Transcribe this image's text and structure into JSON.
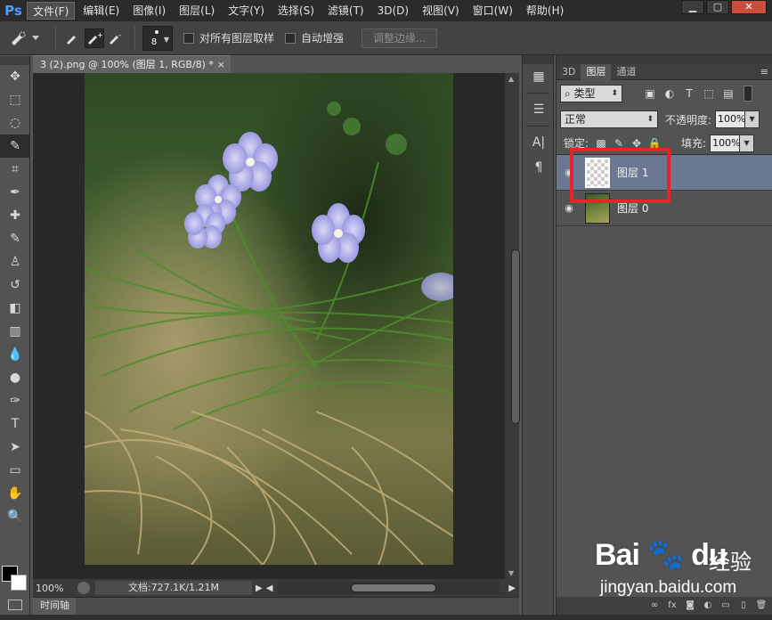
{
  "app": {
    "logo": "Ps",
    "window_buttons": {
      "minimize": "▁",
      "maximize": "▢",
      "close": "✕"
    }
  },
  "menu": {
    "items": [
      {
        "label": "文件(F)",
        "active": true
      },
      {
        "label": "编辑(E)"
      },
      {
        "label": "图像(I)"
      },
      {
        "label": "图层(L)"
      },
      {
        "label": "文字(Y)"
      },
      {
        "label": "选择(S)"
      },
      {
        "label": "滤镜(T)"
      },
      {
        "label": "3D(D)"
      },
      {
        "label": "视图(V)"
      },
      {
        "label": "窗口(W)"
      },
      {
        "label": "帮助(H)"
      }
    ]
  },
  "options": {
    "brush_size": "8",
    "sample_all_layers": "对所有图层取样",
    "auto_enhance": "自动增强",
    "refine_edge": "调整边缘..."
  },
  "tools": [
    {
      "name": "move-tool",
      "icon": "✥"
    },
    {
      "name": "marquee-tool",
      "icon": "⬚"
    },
    {
      "name": "lasso-tool",
      "icon": "◌"
    },
    {
      "name": "quick-selection-tool",
      "icon": "✎",
      "selected": true
    },
    {
      "name": "crop-tool",
      "icon": "⌗"
    },
    {
      "name": "eyedropper-tool",
      "icon": "✒"
    },
    {
      "name": "healing-brush-tool",
      "icon": "✚"
    },
    {
      "name": "brush-tool",
      "icon": "✎"
    },
    {
      "name": "clone-stamp-tool",
      "icon": "♙"
    },
    {
      "name": "history-brush-tool",
      "icon": "↺"
    },
    {
      "name": "eraser-tool",
      "icon": "◧"
    },
    {
      "name": "gradient-tool",
      "icon": "▥"
    },
    {
      "name": "blur-tool",
      "icon": "💧"
    },
    {
      "name": "dodge-tool",
      "icon": "●"
    },
    {
      "name": "pen-tool",
      "icon": "✑"
    },
    {
      "name": "type-tool",
      "icon": "T"
    },
    {
      "name": "path-selection-tool",
      "icon": "➤"
    },
    {
      "name": "shape-tool",
      "icon": "▭"
    },
    {
      "name": "hand-tool",
      "icon": "✋"
    },
    {
      "name": "zoom-tool",
      "icon": "🔍"
    }
  ],
  "document": {
    "tab_title": "3 (2).png @ 100% (图层 1, RGB/8) *",
    "tab_close": "×",
    "zoom": "100%",
    "doc_size": "文档:727.1K/1.21M",
    "timeline": "时间轴"
  },
  "layers_panel": {
    "tabs": [
      "3D",
      "图层",
      "通道"
    ],
    "active_tab": 1,
    "filter_kind": "类型",
    "blend_mode": "正常",
    "opacity_label": "不透明度:",
    "opacity_value": "100%",
    "lock_label": "锁定:",
    "fill_label": "填充:",
    "fill_value": "100%",
    "layers": [
      {
        "name": "图层 1",
        "selected": true,
        "visible_icon": "eye-icon",
        "thumbnail": "transparent"
      },
      {
        "name": "图层 0",
        "selected": false,
        "visible_icon": "eye-icon",
        "thumbnail": "photo"
      }
    ]
  },
  "watermark": {
    "brand": "Bai 🐾 du",
    "label": "经验",
    "url": "jingyan.baidu.com"
  },
  "colors": {
    "highlight": "#e8232a",
    "selected_layer": "#6a7891",
    "ps_blue": "#4aa0ff"
  }
}
